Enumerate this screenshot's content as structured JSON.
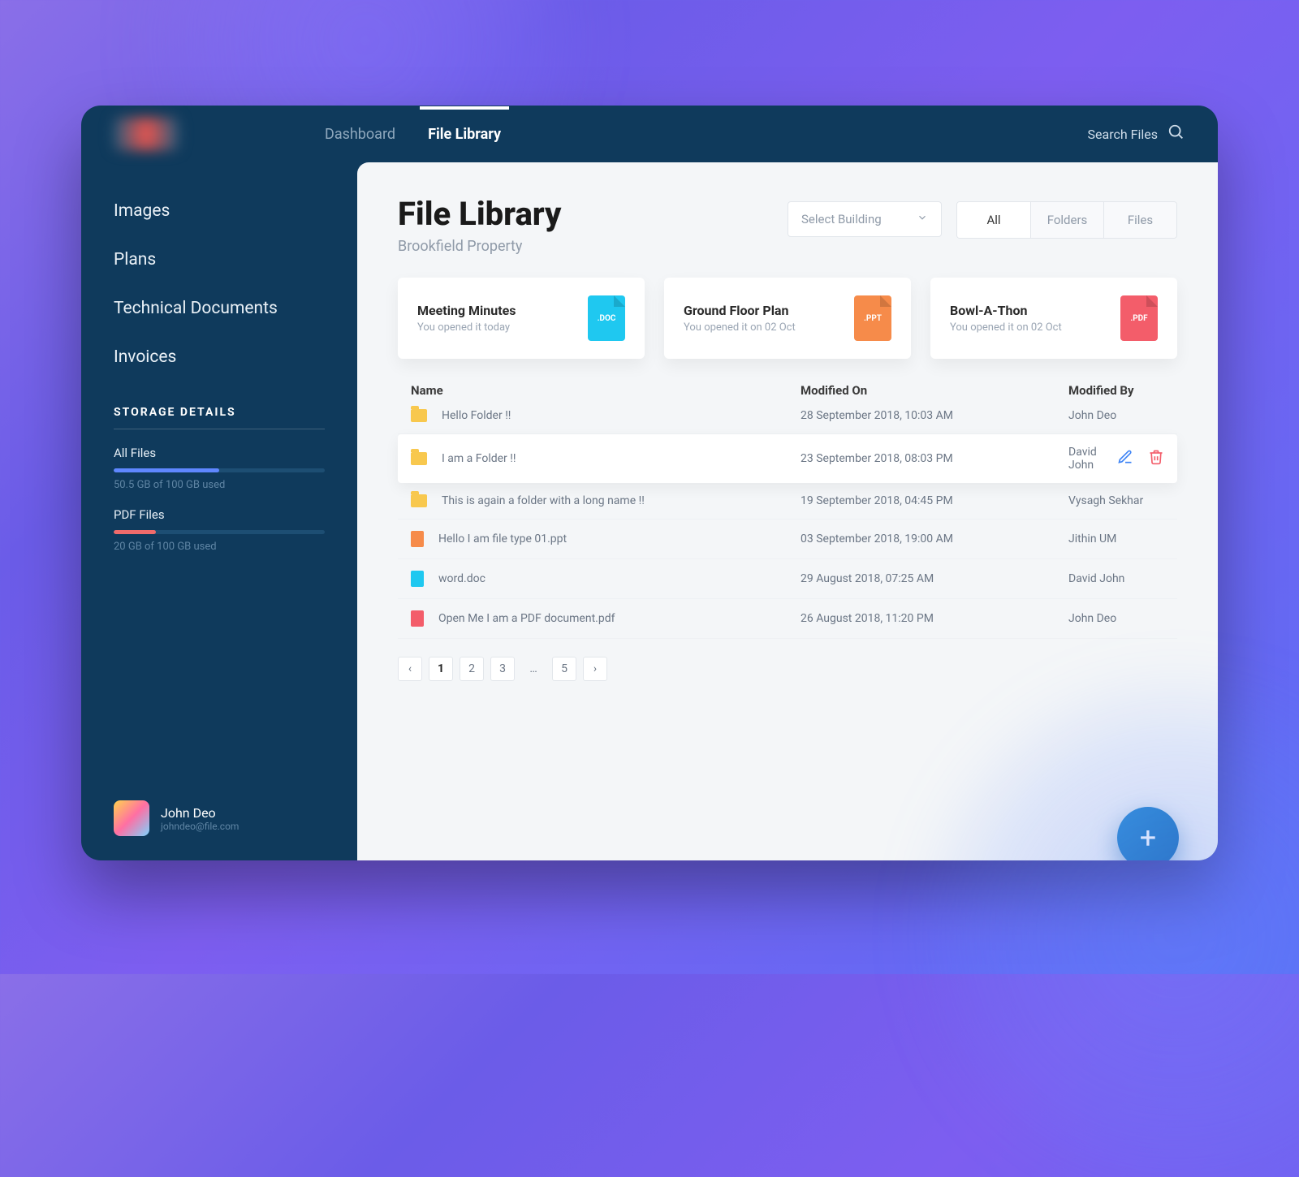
{
  "topbar": {
    "tabs": [
      "Dashboard",
      "File Library"
    ],
    "active_tab": 1,
    "search_placeholder": "Search Files"
  },
  "sidebar": {
    "items": [
      "Images",
      "Plans",
      "Technical Documents",
      "Invoices"
    ],
    "storage_header": "STORAGE DETAILS",
    "storage": [
      {
        "label": "All Files",
        "sub": "50.5 GB of 100 GB used",
        "color": "blue",
        "pct": 50
      },
      {
        "label": "PDF Files",
        "sub": "20 GB of 100 GB used",
        "color": "red",
        "pct": 20
      }
    ],
    "user": {
      "name": "John Deo",
      "email": "johndeo@file.com"
    }
  },
  "page": {
    "title": "File Library",
    "subtitle": "Brookfield Property",
    "select_placeholder": "Select Building",
    "filters": [
      "All",
      "Folders",
      "Files"
    ],
    "active_filter": 0
  },
  "recent_cards": [
    {
      "title": "Meeting Minutes",
      "sub": "You opened it today",
      "ext": ".DOC",
      "kind": "doc"
    },
    {
      "title": "Ground Floor Plan",
      "sub": "You opened it on 02 Oct",
      "ext": ".PPT",
      "kind": "ppt"
    },
    {
      "title": "Bowl-A-Thon",
      "sub": "You opened it on 02 Oct",
      "ext": ".PDF",
      "kind": "pdf"
    }
  ],
  "table": {
    "columns": [
      "Name",
      "Modified On",
      "Modified By"
    ],
    "rows": [
      {
        "icon": "folder",
        "name": "Hello Folder !!",
        "modified": "28 September 2018, 10:03 AM",
        "by": "John Deo"
      },
      {
        "icon": "folder",
        "name": "I am a Folder !!",
        "modified": "23 September 2018, 08:03 PM",
        "by": "David John",
        "selected": true
      },
      {
        "icon": "folder",
        "name": "This is again a folder with a long name !!",
        "modified": "19 September 2018, 04:45 PM",
        "by": "Vysagh Sekhar"
      },
      {
        "icon": "ppt",
        "name": "Hello I am file type 01.ppt",
        "modified": "03 September 2018, 19:00 AM",
        "by": "Jithin UM"
      },
      {
        "icon": "doc",
        "name": "word.doc",
        "modified": "29 August 2018, 07:25 AM",
        "by": "David John"
      },
      {
        "icon": "pdf",
        "name": "Open Me I am a PDF document.pdf",
        "modified": "26 August 2018, 11:20 PM",
        "by": "John Deo"
      }
    ]
  },
  "pagination": {
    "pages": [
      "1",
      "2",
      "3",
      "…",
      "5"
    ],
    "active": 0
  }
}
